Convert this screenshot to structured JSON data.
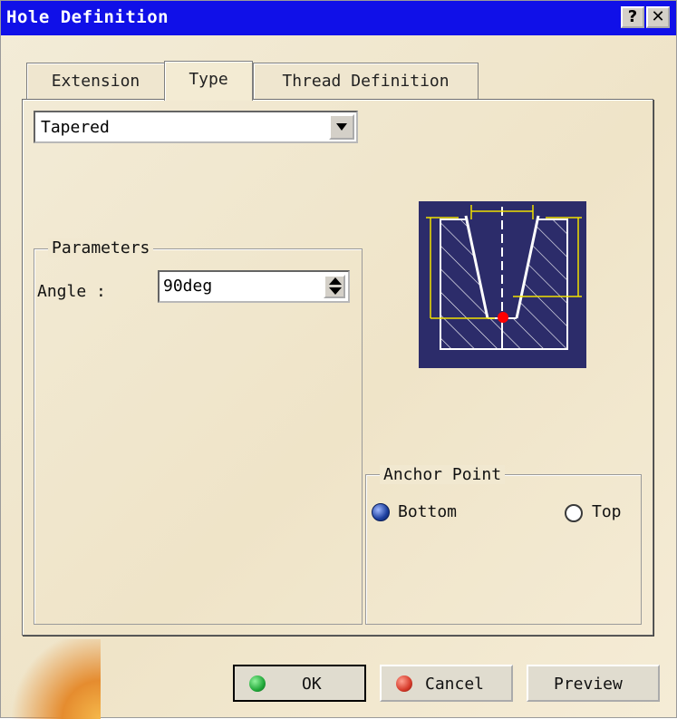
{
  "window": {
    "title": "Hole Definition",
    "help_label": "?",
    "close_label": "✕"
  },
  "tabs": [
    {
      "label": "Extension"
    },
    {
      "label": "Type",
      "active": true
    },
    {
      "label": "Thread Definition"
    }
  ],
  "type_select": {
    "value": "Tapered"
  },
  "parameters": {
    "legend": "Parameters",
    "angle_label": "Angle :",
    "angle_value": "90deg"
  },
  "anchor": {
    "legend": "Anchor Point",
    "options": [
      {
        "label": "Bottom",
        "selected": true
      },
      {
        "label": "Top",
        "selected": false
      }
    ]
  },
  "buttons": {
    "ok": "OK",
    "cancel": "Cancel",
    "preview": "Preview"
  },
  "colors": {
    "title_bar": "#1010e8",
    "diagram_bg": "#2c2c6a",
    "ok_dot": "#22a83a",
    "cancel_dot": "#d63a2a",
    "anchor_point": "#ff0000",
    "dimension": "#f0e000"
  },
  "icons": {
    "ok": "green-orb-icon",
    "cancel": "red-orb-icon",
    "help": "help-question-icon",
    "close": "close-x-icon",
    "diagram": "tapered-hole-diagram-icon"
  }
}
